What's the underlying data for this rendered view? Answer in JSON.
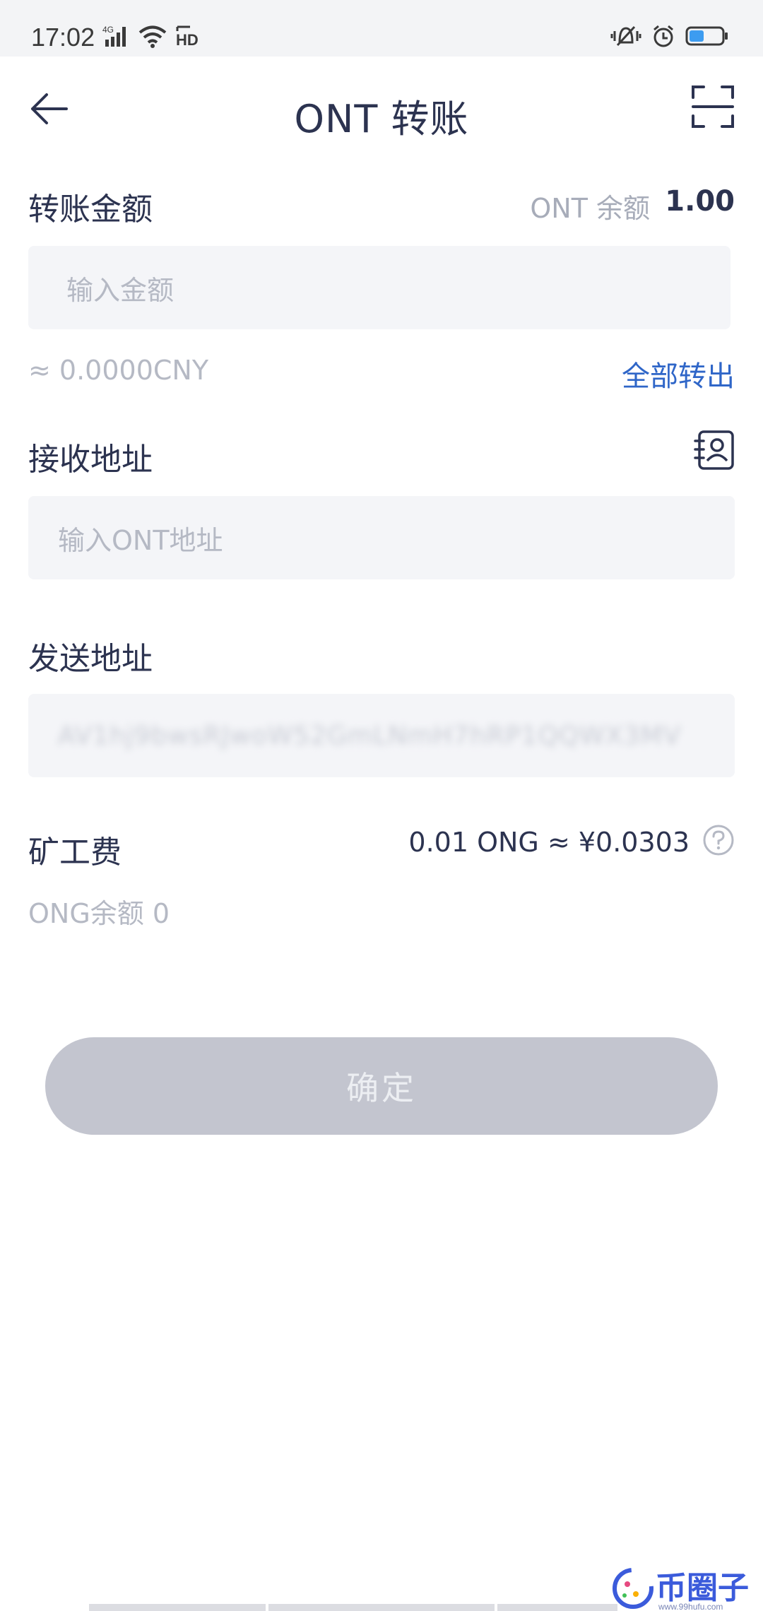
{
  "status_bar": {
    "time": "17:02",
    "network": "4G",
    "hd": "HD"
  },
  "header": {
    "title": "ONT 转账"
  },
  "amount": {
    "label": "转账金额",
    "balance_label": "ONT 余额",
    "balance_value": "1.00",
    "placeholder": "输入金额",
    "cny_estimate": "≈ 0.0000CNY",
    "all_out_label": "全部转出"
  },
  "receive": {
    "label": "接收地址",
    "placeholder": "输入ONT地址"
  },
  "send": {
    "label": "发送地址",
    "address": "AV1hj9bwsRJwoW52GmLNmH7hRP1QQWX3MV"
  },
  "fee": {
    "label": "矿工费",
    "value": "0.01  ONG ≈ ¥0.0303",
    "ong_balance": "ONG余额 0"
  },
  "confirm": {
    "label": "确定"
  },
  "watermark": {
    "text": "币圈子",
    "url": "www.99hufu.com"
  },
  "colors": {
    "primary_text": "#2c3350",
    "muted_text": "#a7acb9",
    "accent_blue": "#2f66c8",
    "input_bg": "#f4f5f8",
    "button_disabled": "#c3c5cf"
  }
}
